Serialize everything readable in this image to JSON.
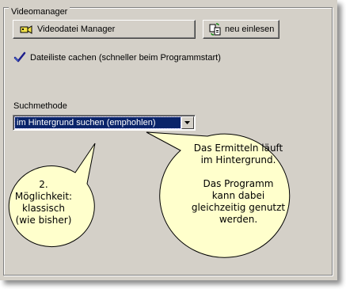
{
  "group": {
    "title": "Videomanager"
  },
  "buttons": {
    "manager_label": "Videodatei Manager",
    "reload_label": "neu einlesen"
  },
  "cache_checkbox": {
    "label": "Dateiliste cachen (schneller beim Programmstart)",
    "checked": true
  },
  "search_method": {
    "label": "Suchmethode",
    "selected": "im Hintergrund suchen (emphohlen)"
  },
  "callouts": {
    "left": [
      "2. Möglichkeit:",
      "klassisch",
      "(wie bisher)"
    ],
    "right_para1": [
      "Das Ermitteln läuft",
      "im Hintergrund."
    ],
    "right_para2": [
      "Das Programm",
      "kann dabei",
      "gleichzeitig genutzt",
      "werden."
    ]
  },
  "colors": {
    "dialog_bg": "#d4d0c8",
    "balloon_fill": "#ffffcc",
    "selection_bg": "#0a246a"
  },
  "icons": {
    "manager": "film-camera-icon",
    "reload": "refresh-files-icon",
    "dropdown": "chevron-down-icon"
  }
}
